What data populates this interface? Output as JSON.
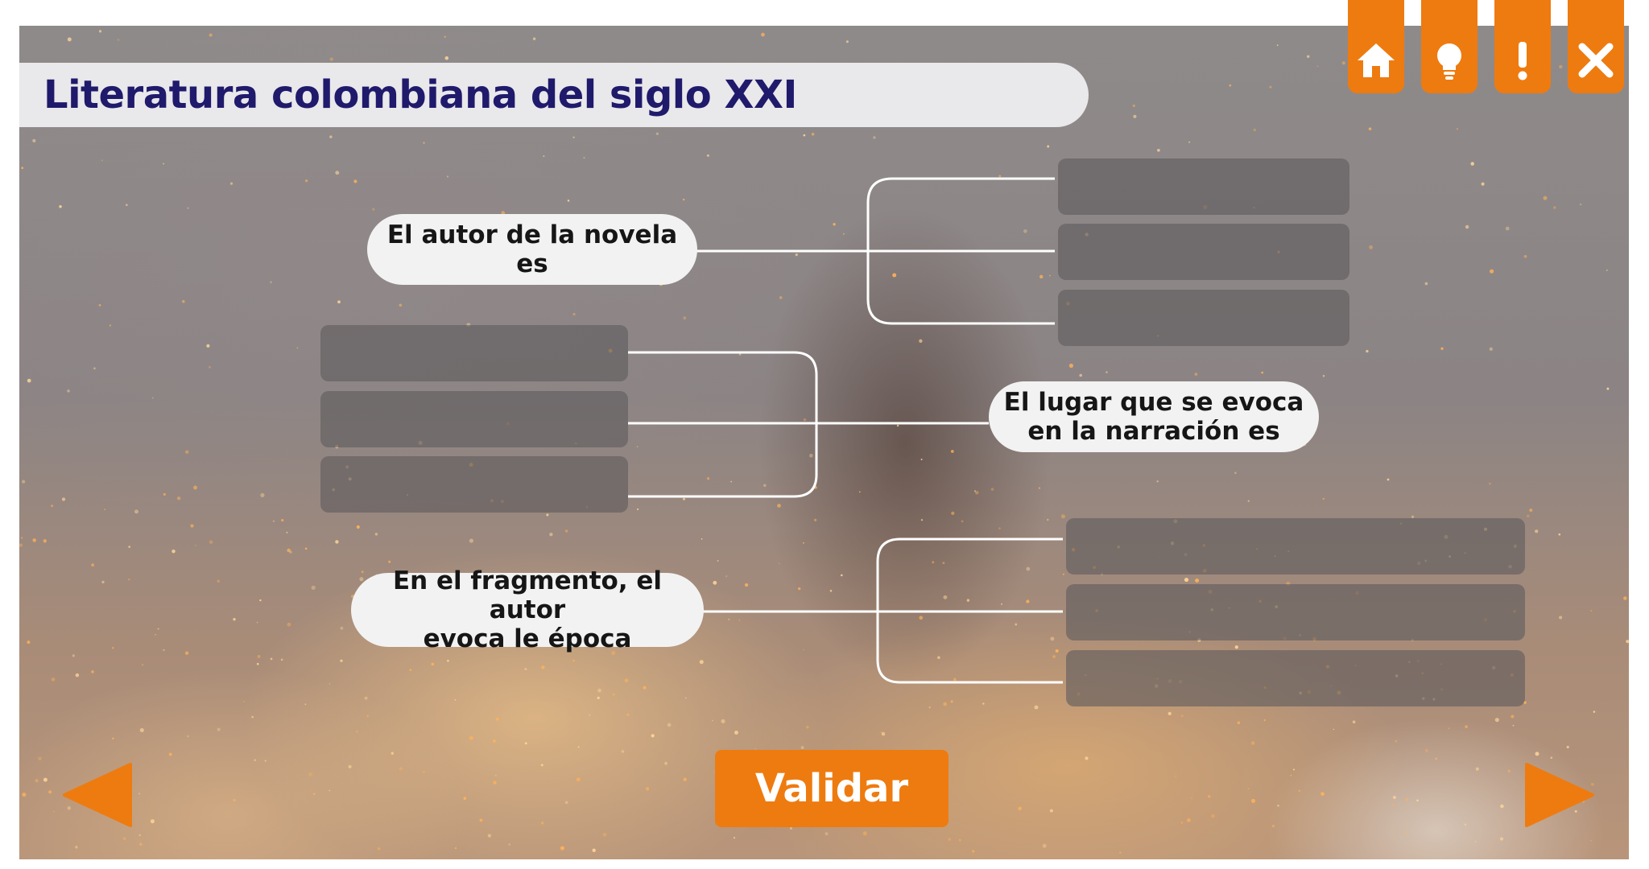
{
  "title": "Literatura colombiana del siglo XXI",
  "toolbar": {
    "icons": [
      "home-icon",
      "lightbulb-icon",
      "exclamation-icon",
      "close-icon"
    ],
    "accent_color": "#ee7b0f"
  },
  "groups": [
    {
      "prompt": "El autor de la novela\nes",
      "answer_slots": 3
    },
    {
      "prompt": "El lugar que se evoca\nen la narración es",
      "answer_slots": 3
    },
    {
      "prompt": "En el fragmento, el autor\nevoca le época",
      "answer_slots": 3
    }
  ],
  "validate_label": "Validar",
  "navigation": {
    "prev_icon": "arrow-left-icon",
    "next_icon": "arrow-right-icon"
  },
  "colors": {
    "title_text": "#1f1a6b",
    "title_bar": "#e9e8ea",
    "accent": "#ee7b0f"
  }
}
